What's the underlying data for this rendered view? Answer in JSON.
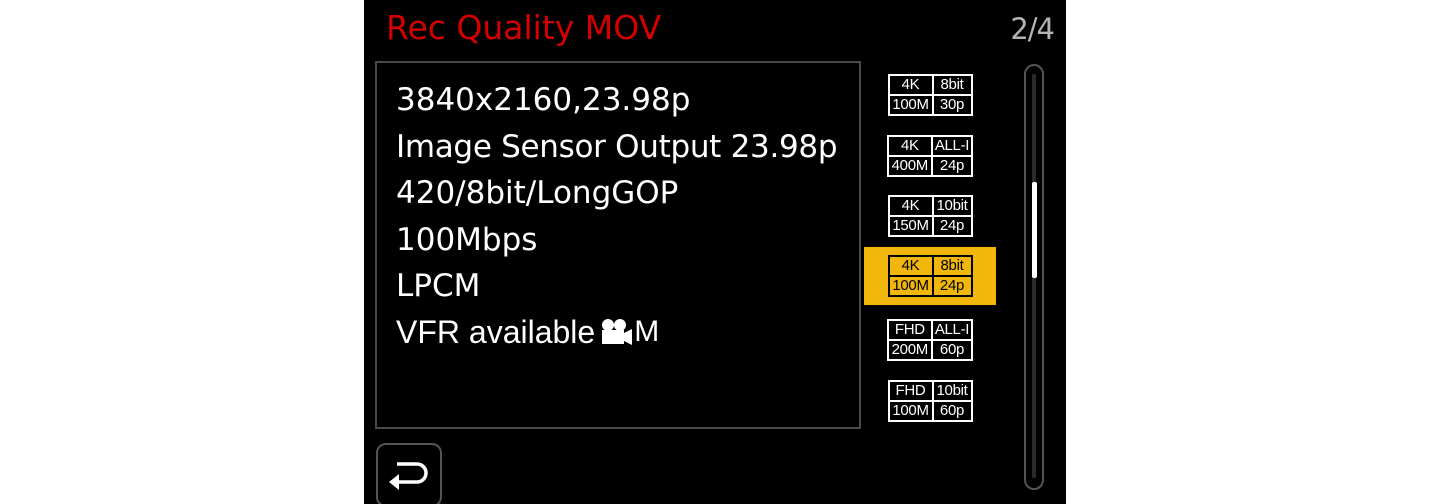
{
  "header": {
    "title": "Rec Quality MOV",
    "page_indicator": "2/4"
  },
  "info": {
    "lines": [
      "3840x2160,23.98p",
      "Image Sensor Output 23.98p",
      "420/8bit/LongGOP",
      "100Mbps",
      "LPCM",
      "VFR available"
    ],
    "vfr_icon": "movie-camera-icon",
    "vfr_icon_suffix": "M"
  },
  "quality_list": [
    {
      "res": "4K",
      "depth": "8bit",
      "bitrate": "100M",
      "fps": "30p",
      "selected": false
    },
    {
      "res": "4K",
      "depth": "ALL-I",
      "bitrate": "400M",
      "fps": "24p",
      "selected": false
    },
    {
      "res": "4K",
      "depth": "10bit",
      "bitrate": "150M",
      "fps": "24p",
      "selected": false
    },
    {
      "res": "4K",
      "depth": "8bit",
      "bitrate": "100M",
      "fps": "24p",
      "selected": true
    },
    {
      "res": "FHD",
      "depth": "ALL-I",
      "bitrate": "200M",
      "fps": "60p",
      "selected": false
    },
    {
      "res": "FHD",
      "depth": "10bit",
      "bitrate": "100M",
      "fps": "60p",
      "selected": false
    }
  ],
  "colors": {
    "title": "#d40000",
    "selected_bg": "#f2b70c",
    "background": "#000000"
  },
  "scrollbar": {
    "position_fraction": 0.28
  },
  "back_button": {
    "icon": "return-arrow-icon"
  }
}
